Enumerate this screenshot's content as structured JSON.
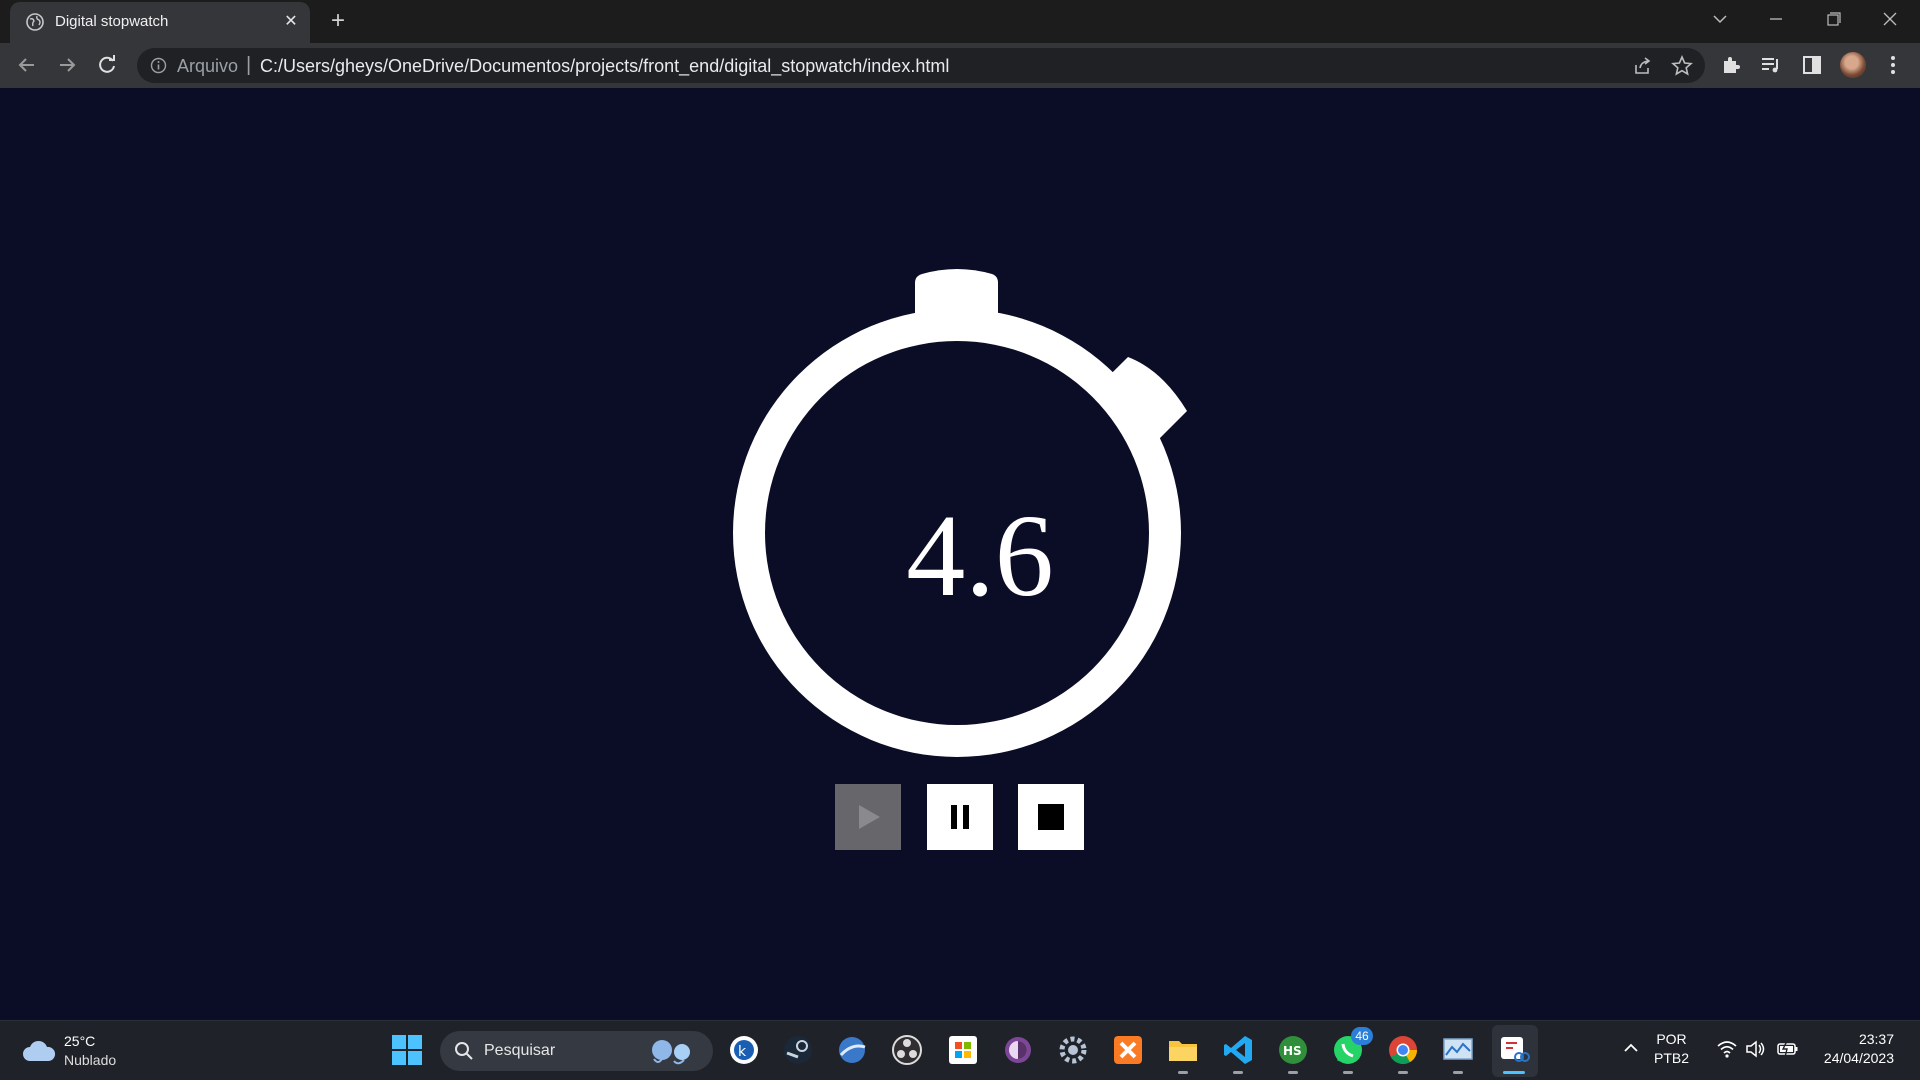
{
  "browser": {
    "tab": {
      "title": "Digital stopwatch",
      "close": "✕"
    },
    "new_tab": "+",
    "address": {
      "scheme_label": "Arquivo",
      "separator": "|",
      "url": "C:/Users/gheys/OneDrive/Documentos/projects/front_end/digital_stopwatch/index.html"
    }
  },
  "stopwatch": {
    "time": "4.6",
    "buttons": {
      "start_state": "disabled",
      "pause_state": "enabled",
      "stop_state": "enabled"
    }
  },
  "taskbar": {
    "weather": {
      "temp": "25°C",
      "condition": "Nublado"
    },
    "search": {
      "placeholder": "Pesquisar"
    },
    "apps": [
      "start",
      "search",
      "kaspersky",
      "steam",
      "browser-blue",
      "obs",
      "ms-store",
      "tor",
      "settings",
      "xampp",
      "file-explorer",
      "vscode",
      "hs",
      "whatsapp",
      "chrome",
      "resource-monitor",
      "snipping-tool"
    ],
    "whatsapp_badge": "46",
    "language": {
      "line1": "POR",
      "line2": "PTB2"
    },
    "time": "23:37",
    "date": "24/04/2023"
  },
  "colors": {
    "page_bg": "#0b0c26",
    "stopwatch": "#ffffff",
    "start_disabled": "#67676b",
    "taskbar_bg": "#1f2329"
  }
}
